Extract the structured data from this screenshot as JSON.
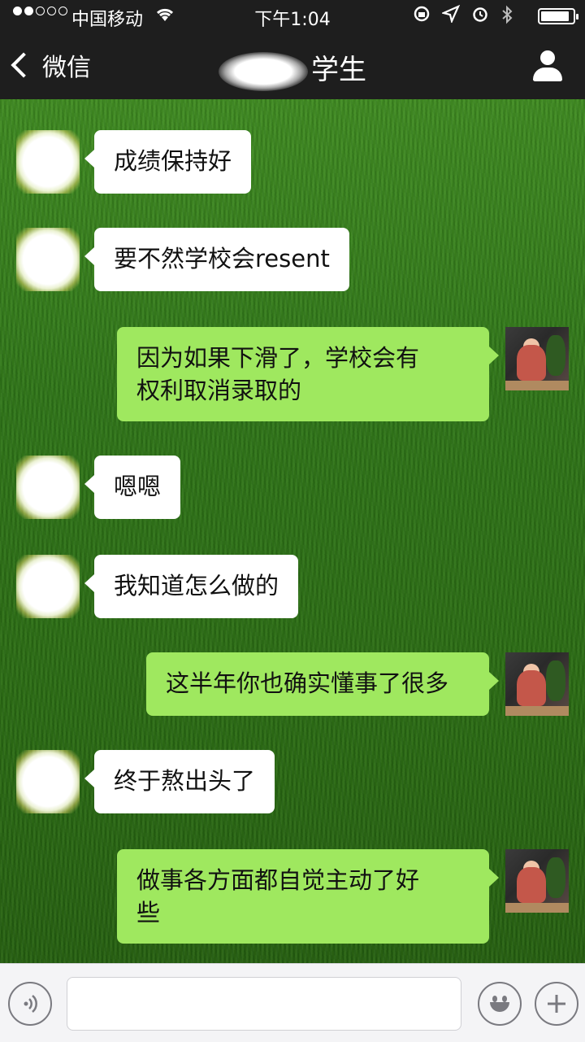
{
  "status_bar": {
    "carrier": "中国移动",
    "time": "下午1:04",
    "signal_bars_filled": 2,
    "signal_bars_total": 5,
    "battery_level": 0.9
  },
  "nav": {
    "back_label": "微信",
    "title_visible": "学生",
    "profile_icon": "person-icon"
  },
  "messages": [
    {
      "side": "in",
      "text": "成绩保持好"
    },
    {
      "side": "in",
      "text": "要不然学校会resent"
    },
    {
      "side": "out",
      "text": "因为如果下滑了，学校会有\n权利取消录取的"
    },
    {
      "side": "in",
      "text": "嗯嗯"
    },
    {
      "side": "in",
      "text": "我知道怎么做的"
    },
    {
      "side": "out",
      "text": "这半年你也确实懂事了很多"
    },
    {
      "side": "in",
      "text": "终于熬出头了"
    },
    {
      "side": "out",
      "text": "做事各方面都自觉主动了好\n些"
    }
  ],
  "input_bar": {
    "voice_icon": "voice-icon",
    "emoji_icon": "emoji-icon",
    "plus_icon": "plus-icon",
    "placeholder": ""
  },
  "colors": {
    "bubble_out": "#9fe85f",
    "bubble_in": "#ffffff",
    "header_bg": "#1e1e1e",
    "grass": "#2f7419"
  }
}
